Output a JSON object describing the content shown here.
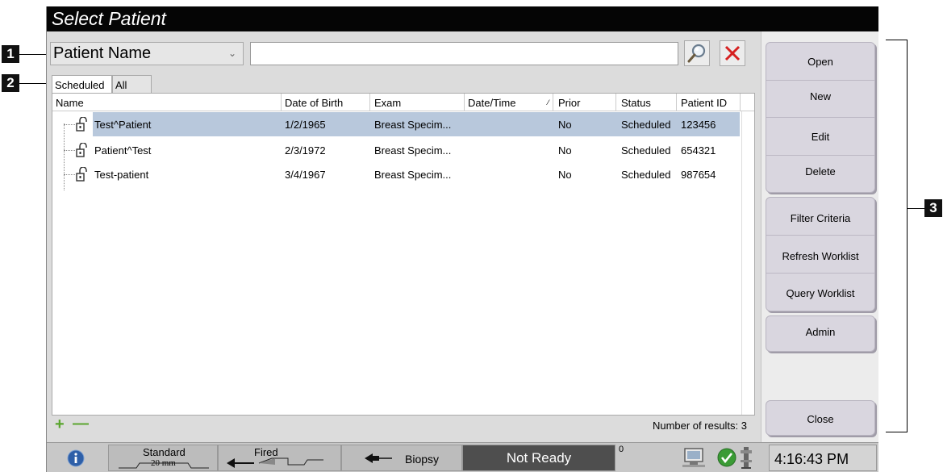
{
  "window": {
    "title": "Select Patient"
  },
  "callouts": {
    "one": "1",
    "two": "2",
    "three": "3"
  },
  "search": {
    "field_selected": "Patient Name",
    "input_value": "",
    "input_placeholder": "",
    "search_icon": "magnifier-icon",
    "clear_icon": "red-x-icon"
  },
  "tabs": [
    {
      "label": "Scheduled",
      "active": true
    },
    {
      "label": "All",
      "active": false
    }
  ],
  "table": {
    "columns": [
      "Name",
      "Date of Birth",
      "Exam",
      "Date/Time",
      "Prior",
      "Status",
      "Patient ID"
    ],
    "rows": [
      {
        "name": "Test^Patient",
        "dob": "1/2/1965",
        "exam": "Breast Specim...",
        "datetime": "",
        "prior": "No",
        "status": "Scheduled",
        "patient_id": "123456",
        "selected": true
      },
      {
        "name": "Patient^Test",
        "dob": "2/3/1972",
        "exam": "Breast Specim...",
        "datetime": "",
        "prior": "No",
        "status": "Scheduled",
        "patient_id": "654321",
        "selected": false
      },
      {
        "name": "Test-patient",
        "dob": "3/4/1967",
        "exam": "Breast Specim...",
        "datetime": "",
        "prior": "No",
        "status": "Scheduled",
        "patient_id": "987654",
        "selected": false
      }
    ]
  },
  "footer": {
    "results_label": "Number of results: 3"
  },
  "buttons": {
    "open": "Open",
    "new": "New",
    "edit": "Edit",
    "delete": "Delete",
    "filter_criteria": "Filter Criteria",
    "refresh_worklist": "Refresh Worklist",
    "query_worklist": "Query Worklist",
    "admin": "Admin",
    "close": "Close"
  },
  "taskbar": {
    "alerts_count": "0",
    "info_icon": "info-icon",
    "paddle_label": "Standard",
    "paddle_size": "20 mm",
    "fired_label": "Fired",
    "biopsy_label": "Biopsy",
    "status": "Not Ready",
    "system_count": "0",
    "time": "4:16:43 PM",
    "accent": "#2e5fa8",
    "ok_color": "#3a9b35"
  }
}
